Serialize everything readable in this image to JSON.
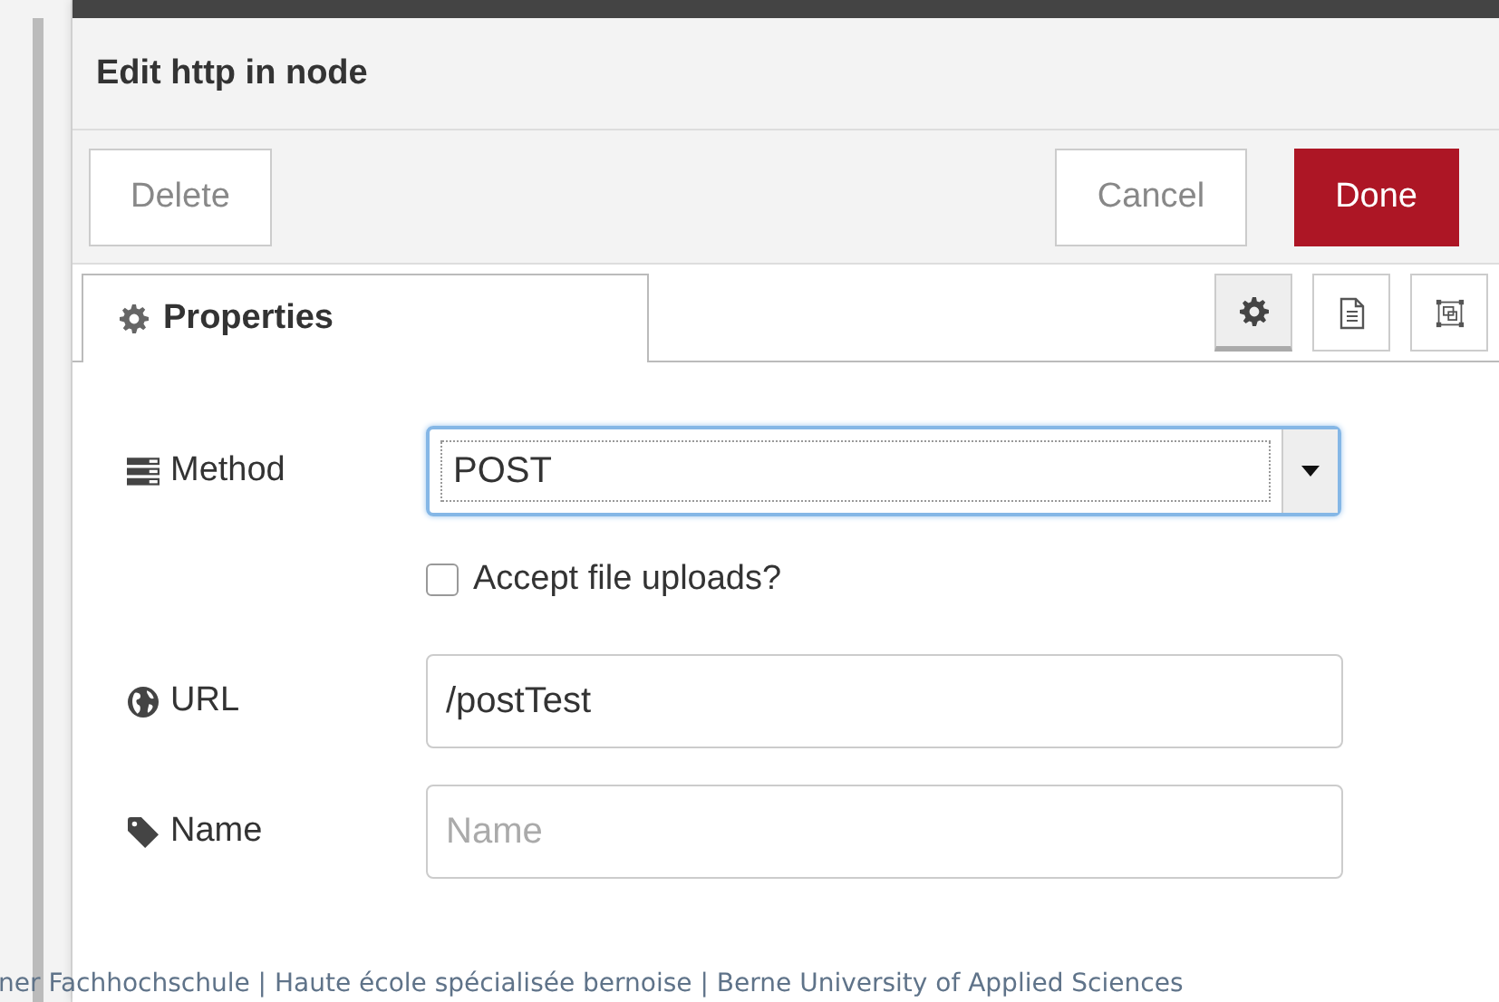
{
  "window": {
    "title": "Edit http in node"
  },
  "actions": [
    {
      "label": "Delete",
      "kind": "default"
    },
    {
      "label": "Cancel",
      "kind": "default"
    },
    {
      "label": "Done",
      "kind": "primary"
    }
  ],
  "tabs": [
    {
      "label": "Properties",
      "selected": true
    }
  ],
  "view_buttons": [
    {
      "kind": "gear",
      "selected": true
    },
    {
      "kind": "document",
      "selected": false
    },
    {
      "kind": "frame",
      "selected": false
    }
  ],
  "form": {
    "rows": [
      {
        "kind": "select",
        "label": "Method",
        "value": "POST"
      },
      {
        "kind": "checkbox",
        "label": "Accept file uploads?",
        "checked": false
      },
      {
        "kind": "text",
        "label": "URL",
        "value": "/postTest"
      },
      {
        "kind": "text",
        "label": "Name",
        "placeholder": "Name"
      }
    ]
  },
  "footer": "ner Fachhochschule | Haute école spécialisée bernoise | Berne University of Applied Sciences"
}
